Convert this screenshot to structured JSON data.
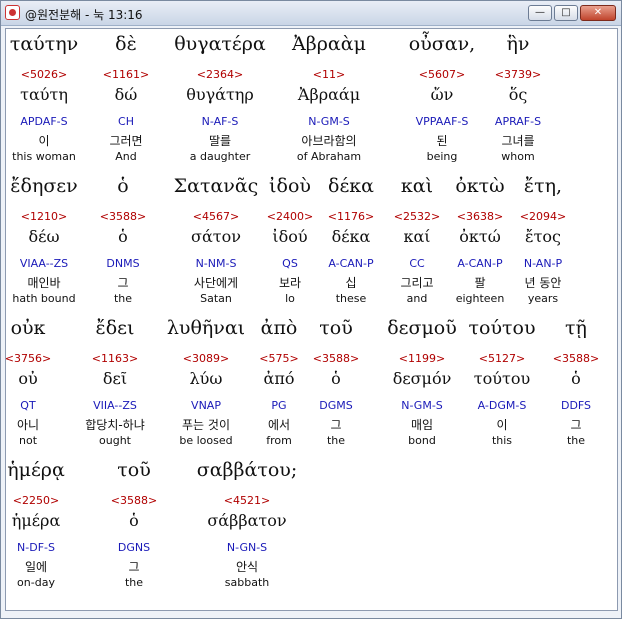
{
  "window": {
    "title": "@원전분해 - 눅 13:16",
    "min_glyph": "—",
    "max_glyph": "□",
    "close_glyph": "✕"
  },
  "rows": [
    {
      "words": [
        {
          "greek": "ταύτην",
          "strong": "<5026>",
          "lexeme": "ταύτη",
          "morph": "APDAF-S",
          "korean": "이",
          "english": "this woman"
        },
        {
          "greek": "δὲ",
          "strong": "<1161>",
          "lexeme": "δώ",
          "morph": "CH",
          "korean": "그러면",
          "english": "And"
        },
        {
          "greek": "θυγατέρα",
          "strong": "<2364>",
          "lexeme": "θυγάτηρ",
          "morph": "N-AF-S",
          "korean": "딸를",
          "english": "a daughter"
        },
        {
          "greek": "Ἀβραὰμ",
          "strong": "<11>",
          "lexeme": "Ἀβραάμ",
          "morph": "N-GM-S",
          "korean": "아브라함의",
          "english": "of Abraham"
        },
        {
          "greek": "οὖσαν,",
          "strong": "<5607>",
          "lexeme": "ὤν",
          "morph": "VPPAAF-S",
          "korean": "된",
          "english": "being"
        },
        {
          "greek": "ἣν",
          "strong": "<3739>",
          "lexeme": "ὅς",
          "morph": "APRAF-S",
          "korean": "그녀를",
          "english": "whom"
        }
      ]
    },
    {
      "words": [
        {
          "greek": "ἔδησεν",
          "strong": "<1210>",
          "lexeme": "δέω",
          "morph": "VIAA--ZS",
          "korean": "매인바",
          "english": "hath bound"
        },
        {
          "greek": "ὁ",
          "strong": "<3588>",
          "lexeme": "ὁ",
          "morph": "DNMS",
          "korean": "그",
          "english": "the"
        },
        {
          "greek": "Σατανᾶς",
          "strong": "<4567>",
          "lexeme": "σάτον",
          "morph": "N-NM-S",
          "korean": "사단에게",
          "english": "Satan"
        },
        {
          "greek": "ἰδοὺ",
          "strong": "<2400>",
          "lexeme": "ἰδού",
          "morph": "QS",
          "korean": "보라",
          "english": "lo"
        },
        {
          "greek": "δέκα",
          "strong": "<1176>",
          "lexeme": "δέκα",
          "morph": "A-CAN-P",
          "korean": "십",
          "english": "these"
        },
        {
          "greek": "καὶ",
          "strong": "<2532>",
          "lexeme": "καί",
          "morph": "CC",
          "korean": "그리고",
          "english": "and"
        },
        {
          "greek": "ὀκτὼ",
          "strong": "<3638>",
          "lexeme": "ὀκτώ",
          "morph": "A-CAN-P",
          "korean": "팔",
          "english": "eighteen"
        },
        {
          "greek": "ἔτη,",
          "strong": "<2094>",
          "lexeme": "ἔτος",
          "morph": "N-AN-P",
          "korean": "년 동안",
          "english": "years"
        }
      ]
    },
    {
      "words": [
        {
          "greek": "οὐκ",
          "strong": "<3756>",
          "lexeme": "οὐ",
          "morph": "QT",
          "korean": "아니",
          "english": "not"
        },
        {
          "greek": "ἔδει",
          "strong": "<1163>",
          "lexeme": "δεῖ",
          "morph": "VIIA--ZS",
          "korean": "합당치-하냐",
          "english": "ought"
        },
        {
          "greek": "λυθῆναι",
          "strong": "<3089>",
          "lexeme": "λύω",
          "morph": "VNAP",
          "korean": "푸는 것이",
          "english": "be loosed"
        },
        {
          "greek": "ἀπὸ",
          "strong": "<575>",
          "lexeme": "ἀπό",
          "morph": "PG",
          "korean": "에서",
          "english": "from"
        },
        {
          "greek": "τοῦ",
          "strong": "<3588>",
          "lexeme": "ὁ",
          "morph": "DGMS",
          "korean": "그",
          "english": "the"
        },
        {
          "greek": "δεσμοῦ",
          "strong": "<1199>",
          "lexeme": "δεσμόν",
          "morph": "N-GM-S",
          "korean": "매임",
          "english": "bond"
        },
        {
          "greek": "τούτου",
          "strong": "<5127>",
          "lexeme": "τούτου",
          "morph": "A-DGM-S",
          "korean": "이",
          "english": "this"
        },
        {
          "greek": "τῇ",
          "strong": "<3588>",
          "lexeme": "ὁ",
          "morph": "DDFS",
          "korean": "그",
          "english": "the"
        }
      ]
    },
    {
      "words": [
        {
          "greek": "ἡμέρᾳ",
          "strong": "<2250>",
          "lexeme": "ἡμέρα",
          "morph": "N-DF-S",
          "korean": "일에",
          "english": "on-day"
        },
        {
          "greek": "τοῦ",
          "strong": "<3588>",
          "lexeme": "ὁ",
          "morph": "DGNS",
          "korean": "그",
          "english": "the"
        },
        {
          "greek": "σαββάτου;",
          "strong": "<4521>",
          "lexeme": "σάββατον",
          "morph": "N-GN-S",
          "korean": "안식",
          "english": "sabbath"
        }
      ]
    }
  ]
}
